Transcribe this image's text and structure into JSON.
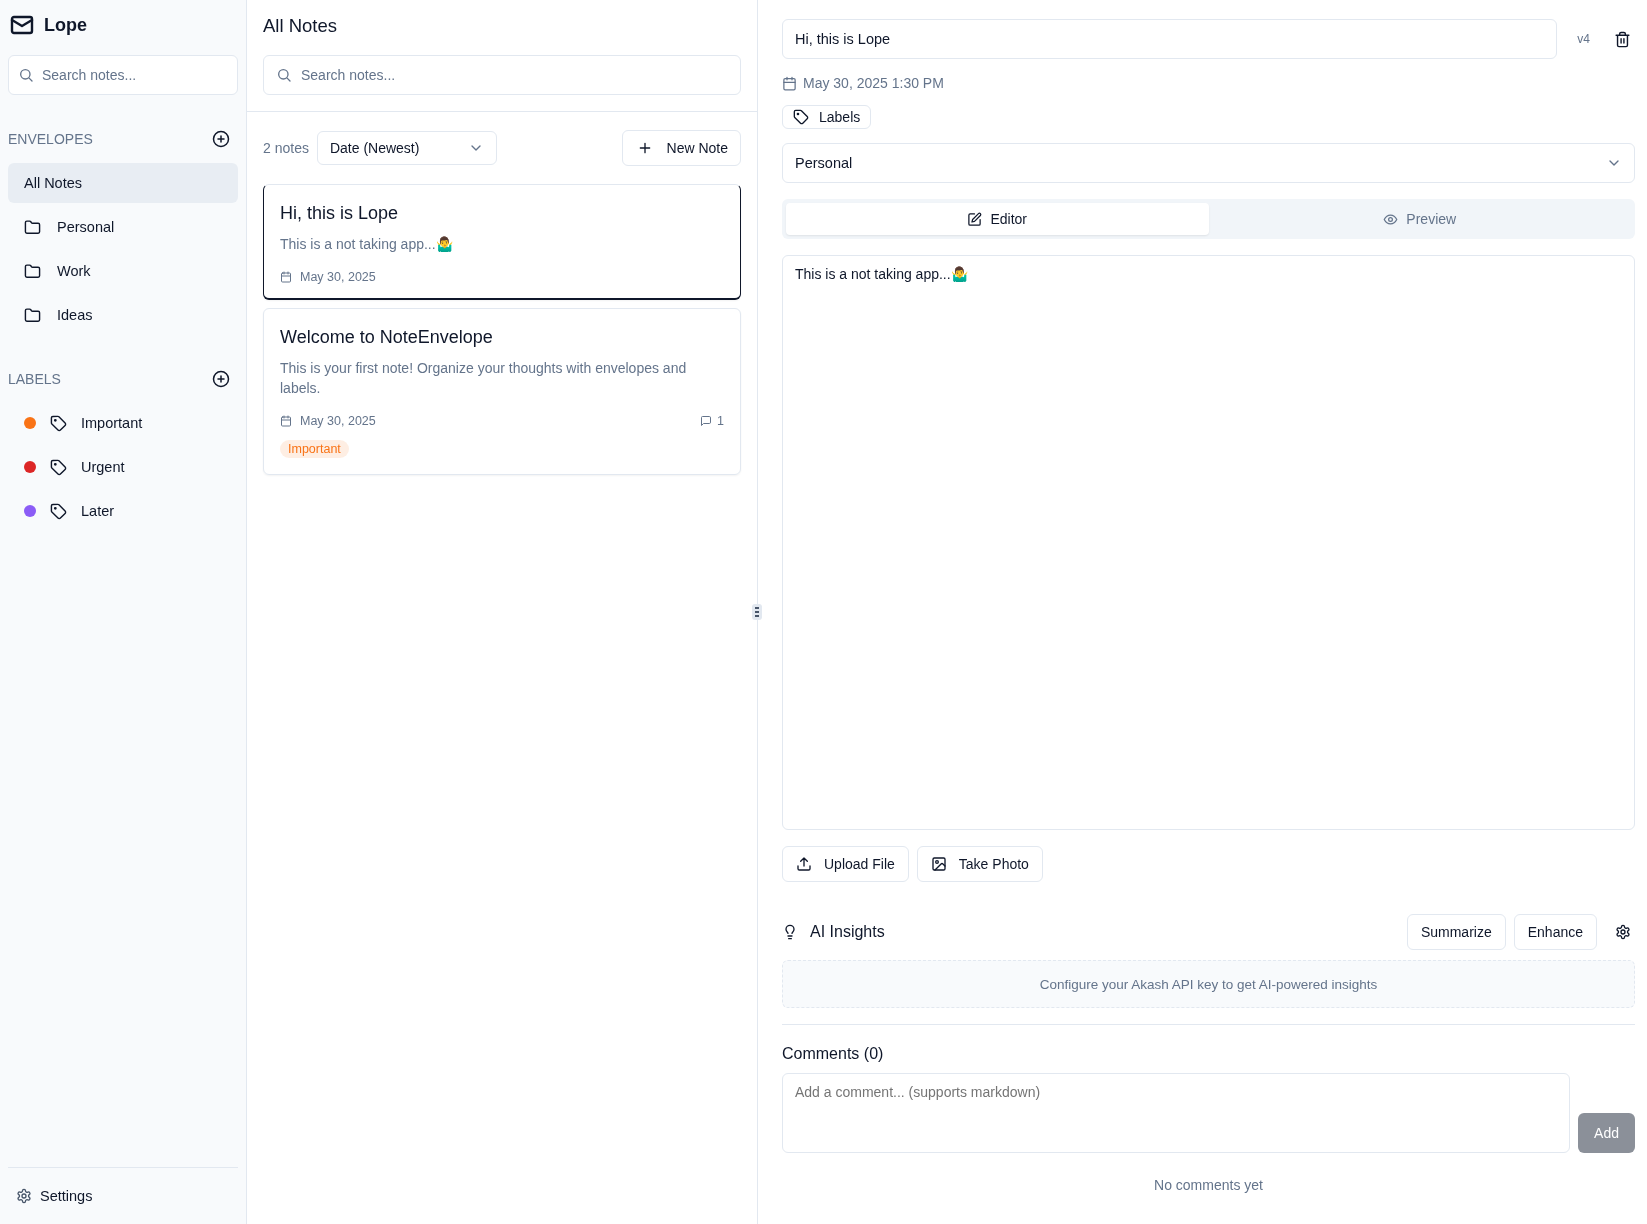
{
  "app": {
    "name": "Lope"
  },
  "sidebar": {
    "search": {
      "placeholder": "Search notes..."
    },
    "envelopes": {
      "heading": "ENVELOPES",
      "items": [
        {
          "label": "All Notes",
          "kind": "all",
          "selected": true
        },
        {
          "label": "Personal",
          "kind": "folder",
          "selected": false
        },
        {
          "label": "Work",
          "kind": "folder",
          "selected": false
        },
        {
          "label": "Ideas",
          "kind": "folder",
          "selected": false
        }
      ]
    },
    "labels": {
      "heading": "LABELS",
      "items": [
        {
          "label": "Important",
          "color": "#f97316"
        },
        {
          "label": "Urgent",
          "color": "#dc2626"
        },
        {
          "label": "Later",
          "color": "#8b5cf6"
        }
      ]
    },
    "settings": "Settings"
  },
  "notes_panel": {
    "title": "All Notes",
    "search": {
      "placeholder": "Search notes..."
    },
    "count": "2 notes",
    "sort": {
      "value": "Date (Newest)"
    },
    "new_button": "New Note",
    "notes": [
      {
        "title": "Hi, this is Lope",
        "preview": "This is a not taking app...🤷‍♂️",
        "date": "May 30, 2025",
        "selected": true
      },
      {
        "title": "Welcome to NoteEnvelope",
        "preview": "This is your first note! Organize your thoughts with envelopes and labels.",
        "date": "May 30, 2025",
        "comments": "1",
        "labels": [
          {
            "label": "Important",
            "color": "#f97316"
          }
        ],
        "selected": false
      }
    ]
  },
  "editor": {
    "title": {
      "value": "Hi, this is Lope"
    },
    "version": "v4",
    "timestamp": "May 30, 2025 1:30 PM",
    "labels_button": "Labels",
    "envelope": {
      "value": "Personal"
    },
    "tabs": [
      {
        "label": "Editor",
        "kind": "edit",
        "selected": true
      },
      {
        "label": "Preview",
        "kind": "preview",
        "selected": false
      }
    ],
    "body": {
      "value": "This is a not taking app...🤷‍♂️"
    },
    "attach_buttons": [
      {
        "label": "Upload File",
        "kind": "upload"
      },
      {
        "label": "Take Photo",
        "kind": "photo"
      }
    ],
    "ai": {
      "title": "AI Insights",
      "buttons": [
        "Summarize",
        "Enhance"
      ],
      "message": "Configure your Akash API key to get AI-powered insights"
    },
    "comments": {
      "title": "Comments (0)",
      "input": {
        "placeholder": "Add a comment... (supports markdown)"
      },
      "add_button": {
        "label": "Add",
        "disabled": true
      },
      "empty": "No comments yet"
    }
  }
}
